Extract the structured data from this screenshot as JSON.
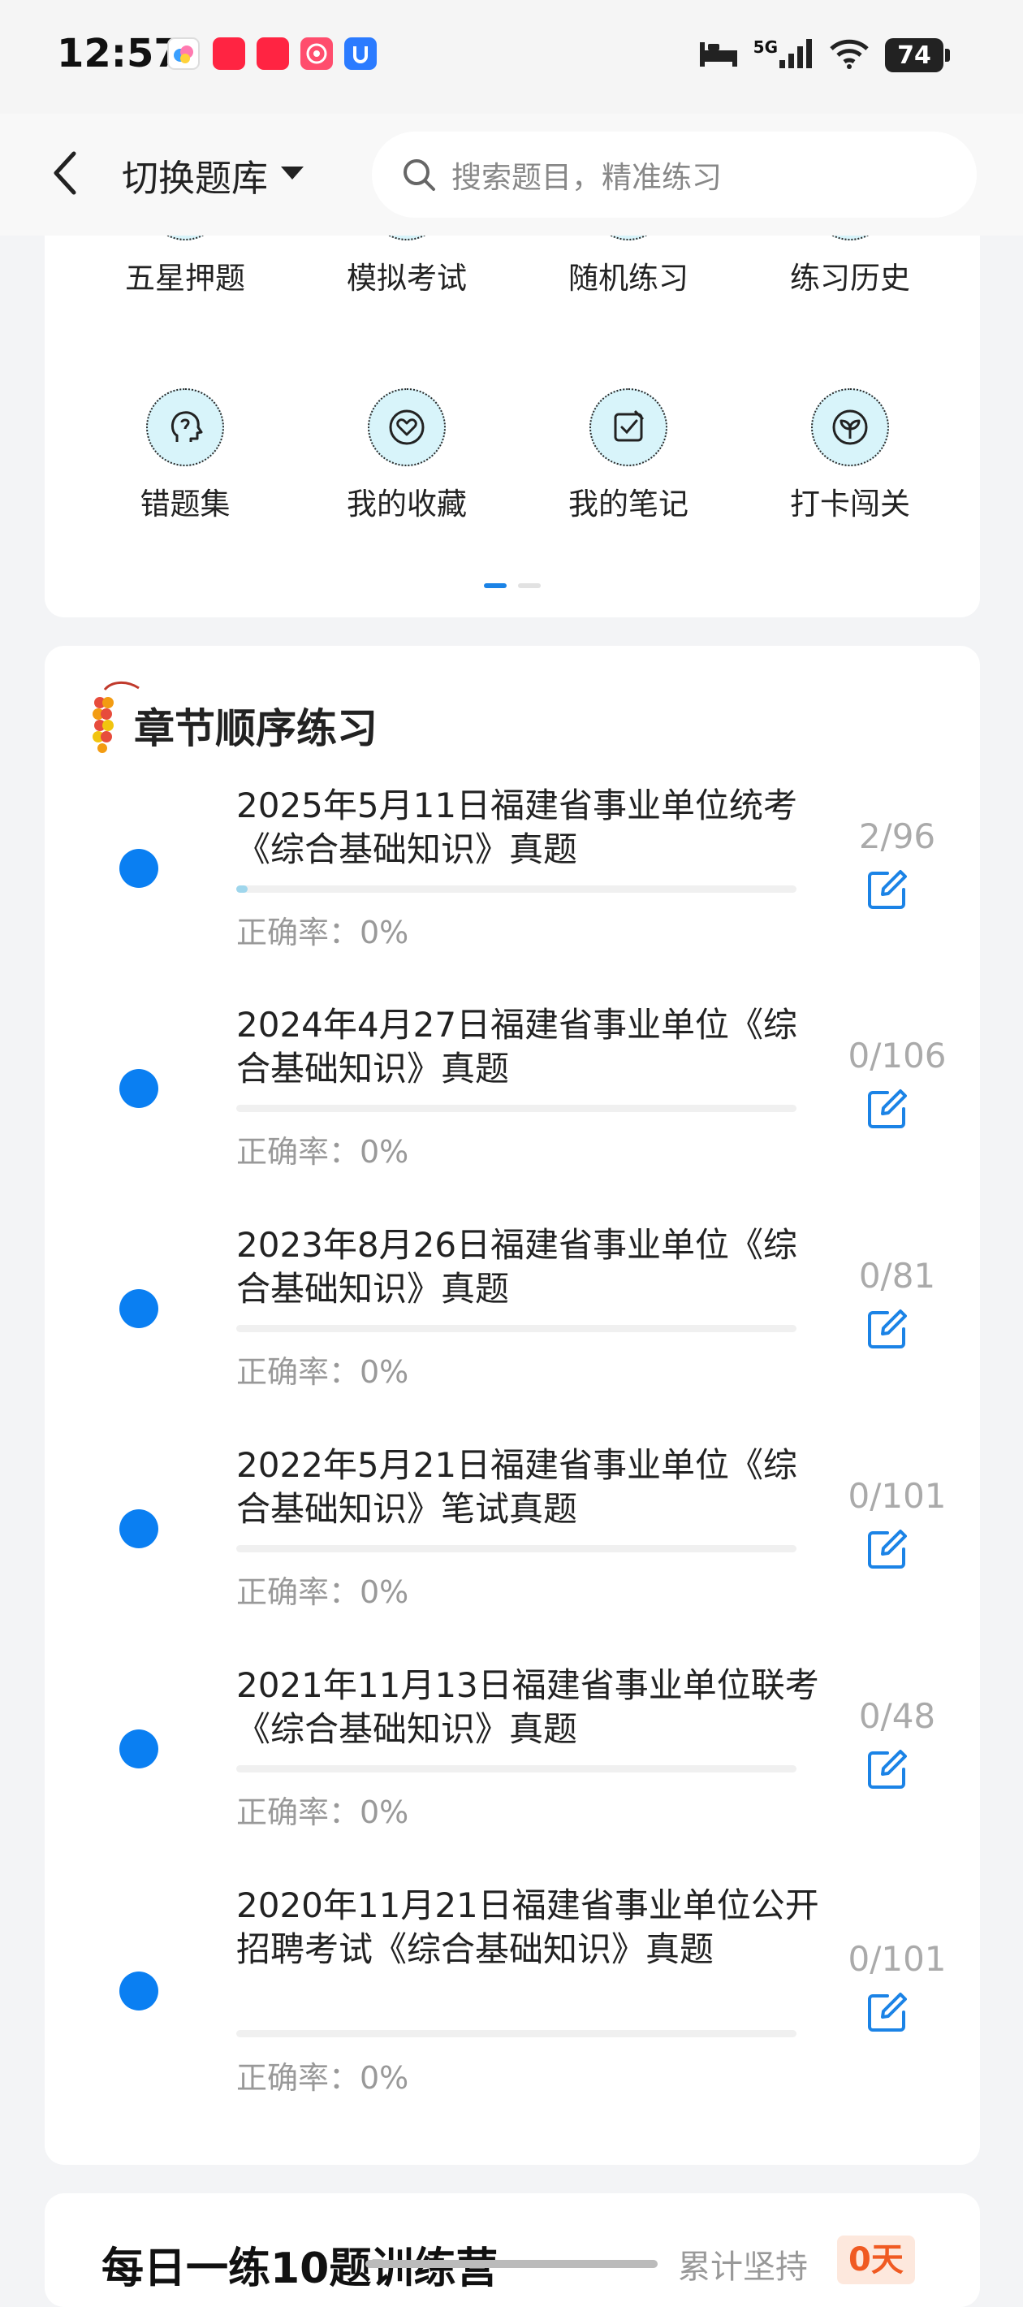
{
  "status_bar": {
    "time": "12:57",
    "network": "5G",
    "battery": "74",
    "notification_icons": [
      "cloud-app-icon",
      "xiaohongshu-icon",
      "xiaohongshu-icon",
      "camera-app-icon",
      "blue-app-icon"
    ]
  },
  "header": {
    "switch_label": "切换题库",
    "search_placeholder": "搜索题目，精准练习"
  },
  "menu": {
    "row1": [
      "五星押题",
      "模拟考试",
      "随机练习",
      "练习历史"
    ],
    "row2": [
      {
        "label": "错题集",
        "icon": "head-icon"
      },
      {
        "label": "我的收藏",
        "icon": "heart-icon"
      },
      {
        "label": "我的笔记",
        "icon": "note-check-icon"
      },
      {
        "label": "打卡闯关",
        "icon": "sprout-icon"
      }
    ],
    "page_index": 1,
    "page_count": 2
  },
  "chapter": {
    "title": "章节顺序练习",
    "items": [
      {
        "title": "2025年5月11日福建省事业单位统考《综合基础知识》真题",
        "rate": "正确率：0%",
        "count": "2/96",
        "progress": 0.02
      },
      {
        "title": "2024年4月27日福建省事业单位《综合基础知识》真题",
        "rate": "正确率：0%",
        "count": "0/106",
        "progress": 0
      },
      {
        "title": "2023年8月26日福建省事业单位《综合基础知识》真题",
        "rate": "正确率：0%",
        "count": "0/81",
        "progress": 0
      },
      {
        "title": "2022年5月21日福建省事业单位《综合基础知识》笔试真题",
        "rate": "正确率：0%",
        "count": "0/101",
        "progress": 0
      },
      {
        "title": "2021年11月13日福建省事业单位联考《综合基础知识》真题",
        "rate": "正确率：0%",
        "count": "0/48",
        "progress": 0
      },
      {
        "title": "2020年11月21日福建省事业单位公开招聘考试《综合基础知识》真题",
        "rate": "正确率：0%",
        "count": "0/101",
        "progress": 0
      }
    ]
  },
  "daily": {
    "title": "每日一练10题训练营",
    "streak_label": "累计坚持",
    "days": "0天"
  },
  "colors": {
    "accent": "#0a7ff2",
    "icon_bg": "#d8f4fa",
    "days_badge": "#f05a22"
  }
}
